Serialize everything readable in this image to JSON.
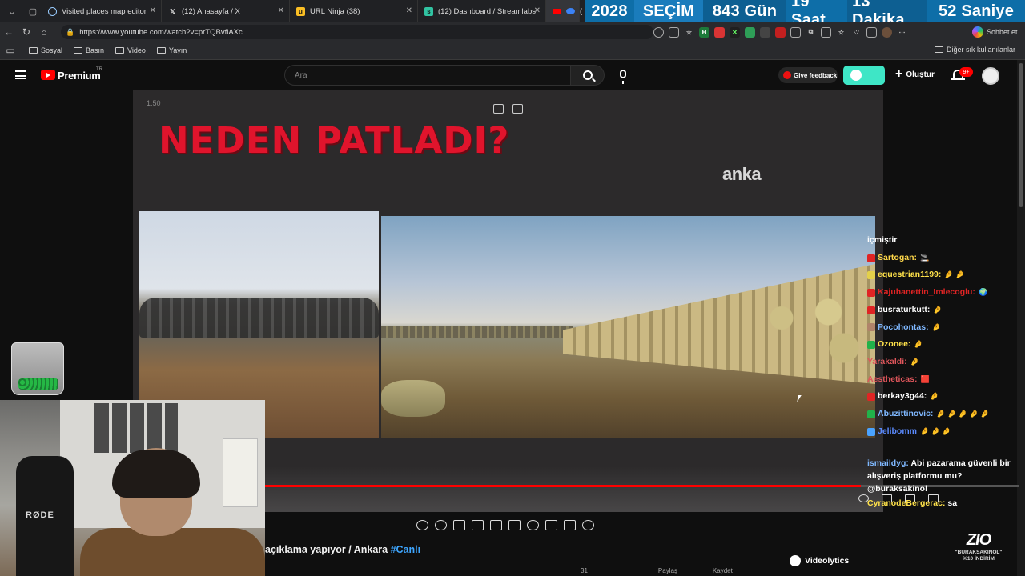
{
  "browser": {
    "tabs": [
      {
        "title": "Visited places map editor",
        "favicon": "globe-icon"
      },
      {
        "title": "(12) Anasayfa / X",
        "favicon": "x-icon"
      },
      {
        "title": "URL Ninja (38)",
        "favicon": "url-ninja-icon"
      },
      {
        "title": "(12) Dashboard / Streamlabs",
        "favicon": "streamlabs-icon"
      },
      {
        "title": "(",
        "favicon": "youtube-icon"
      }
    ],
    "url": "https://www.youtube.com/watch?v=prTQBvflAXc",
    "copilot_label": "Sohbet et",
    "bookmarks": [
      "Sosyal",
      "Basın",
      "Video",
      "Yayın"
    ],
    "other_bookmarks": "Diğer sık kullanılanlar"
  },
  "countdown": {
    "year": "2028",
    "event": "SEÇİM",
    "days": "843 Gün",
    "hours": "19 Saat",
    "minutes": "13 Dakika",
    "seconds": "52 Saniye"
  },
  "youtube": {
    "brand": "Premium",
    "region": "TR",
    "search_placeholder": "Ara",
    "feedback_label": "Give feedback",
    "create_label": "Oluştur",
    "notification_count": "9+"
  },
  "video": {
    "speed": "1.50",
    "headline": "NEDEN PATLADI?",
    "channel_watermark": "anka",
    "progress_fraction": 0.79,
    "title_text": "açıklama yapıyor / Ankara ",
    "title_tag": "#Canlı"
  },
  "chat": {
    "partial_top": "içmiştir",
    "messages": [
      {
        "user": "Sartogan:",
        "color": "#ffd84a",
        "badge": "#e02424",
        "emote": "🚬"
      },
      {
        "user": "equestrian1199:",
        "color": "#ffe24a",
        "badge": "#e3d04a",
        "emote": "🤌 🤌"
      },
      {
        "user": "Kajuhanettin_Imlecoglu:",
        "color": "#e02424",
        "badge": "#e02424",
        "emote": "🌍"
      },
      {
        "user": "busraturkutt:",
        "color": "#ffffff",
        "badge": "#e02424",
        "emote": "🤌"
      },
      {
        "user": "Pocohontas:",
        "color": "#7fb8ff",
        "badge": "#b0836a",
        "emote": "🤌"
      },
      {
        "user": "Ozonee:",
        "color": "#ffe24a",
        "badge": "#21b24a",
        "emote": "🤌"
      },
      {
        "user": "Yarakaldi:",
        "color": "#e0565b",
        "badge": "",
        "emote": "🤌"
      },
      {
        "user": "Aestheticas:",
        "color": "#e0565b",
        "badge": "",
        "emote": "🟥"
      },
      {
        "user": "berkay3g44:",
        "color": "#ffffff",
        "badge": "#e02424",
        "emote": "🤌"
      },
      {
        "user": "Abuzittinovic:",
        "color": "#7fb8ff",
        "badge": "#21b24a",
        "emote": "🤌 🤌 🤌 🤌 🤌"
      },
      {
        "user": "Jelibomm",
        "color": "#5b8bff",
        "badge": "#4aa3ff",
        "emote": "🤌 🤌 🤌"
      }
    ],
    "last_user": "ismaildyg:",
    "last_text": "Abi pazarama güvenli bir alışveriş platformu mu?",
    "mention": "@buraksakinol",
    "trailing_user": "CyranodeBergerac:",
    "trailing_text": "sa"
  },
  "webcam": {
    "mic_brand": "RØDE"
  },
  "below_video": {
    "videolytics": "Videolytics",
    "actions": [
      "31",
      "",
      "Paylaş",
      "Kaydet"
    ]
  },
  "sponsor": {
    "logo": "ZIO",
    "code": "\"BURAKSAKINOL\"",
    "discount": "%10 İNDİRİM"
  }
}
